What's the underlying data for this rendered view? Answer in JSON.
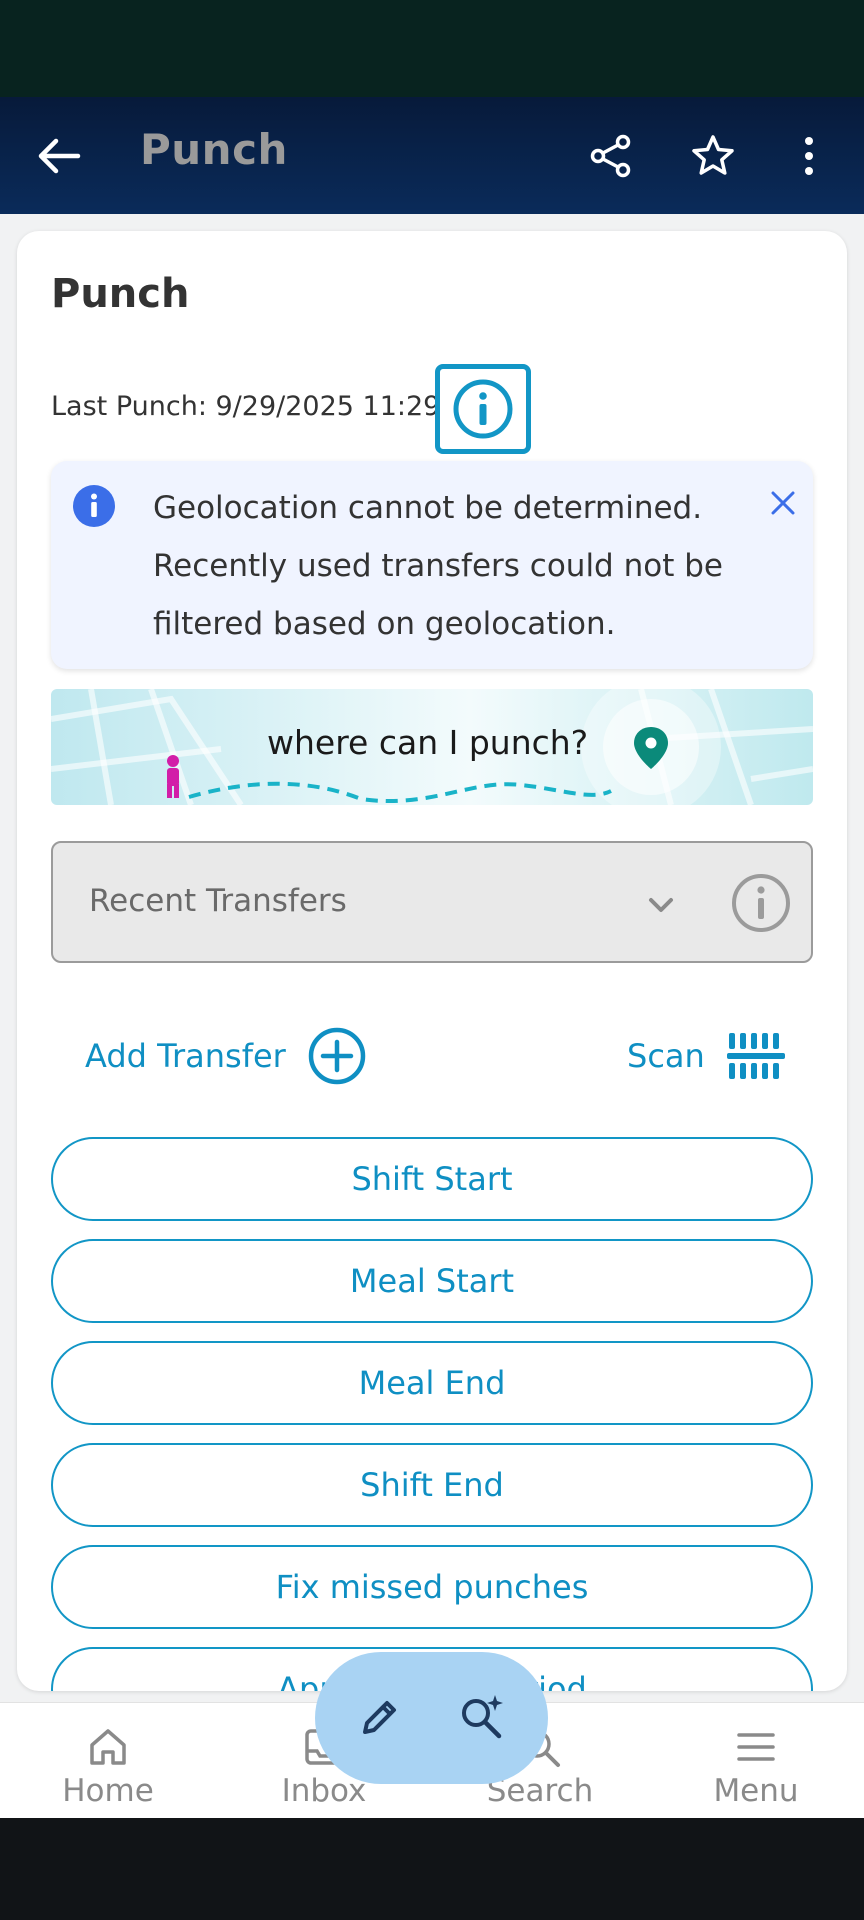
{
  "app_bar": {
    "title": "Punch"
  },
  "card": {
    "title": "Punch",
    "last_punch": "Last Punch: 9/29/2025 11:29"
  },
  "alert": {
    "text": "Geolocation cannot be determined. Recently used transfers could not be filtered based on geolocation."
  },
  "banner": {
    "text": "where can I punch?"
  },
  "recent_transfers": {
    "placeholder": "Recent Transfers"
  },
  "actions": {
    "add_transfer": "Add Transfer",
    "scan": "Scan"
  },
  "punch_buttons": [
    "Shift Start",
    "Meal Start",
    "Meal End",
    "Shift End",
    "Fix missed punches",
    "Approve Pay Period"
  ],
  "bottom_nav": [
    {
      "label": "Home",
      "icon": "home-icon"
    },
    {
      "label": "Inbox",
      "icon": "inbox-icon"
    },
    {
      "label": "Search",
      "icon": "search-icon"
    },
    {
      "label": "Menu",
      "icon": "menu-icon"
    }
  ],
  "colors": {
    "accent": "#1296c6",
    "app_bar": "#0a2b5a",
    "alert_bg": "#f0f4ff",
    "alert_icon": "#3b6ee8",
    "fab": "#a9d3f3",
    "pin": "#0b8a7a"
  }
}
